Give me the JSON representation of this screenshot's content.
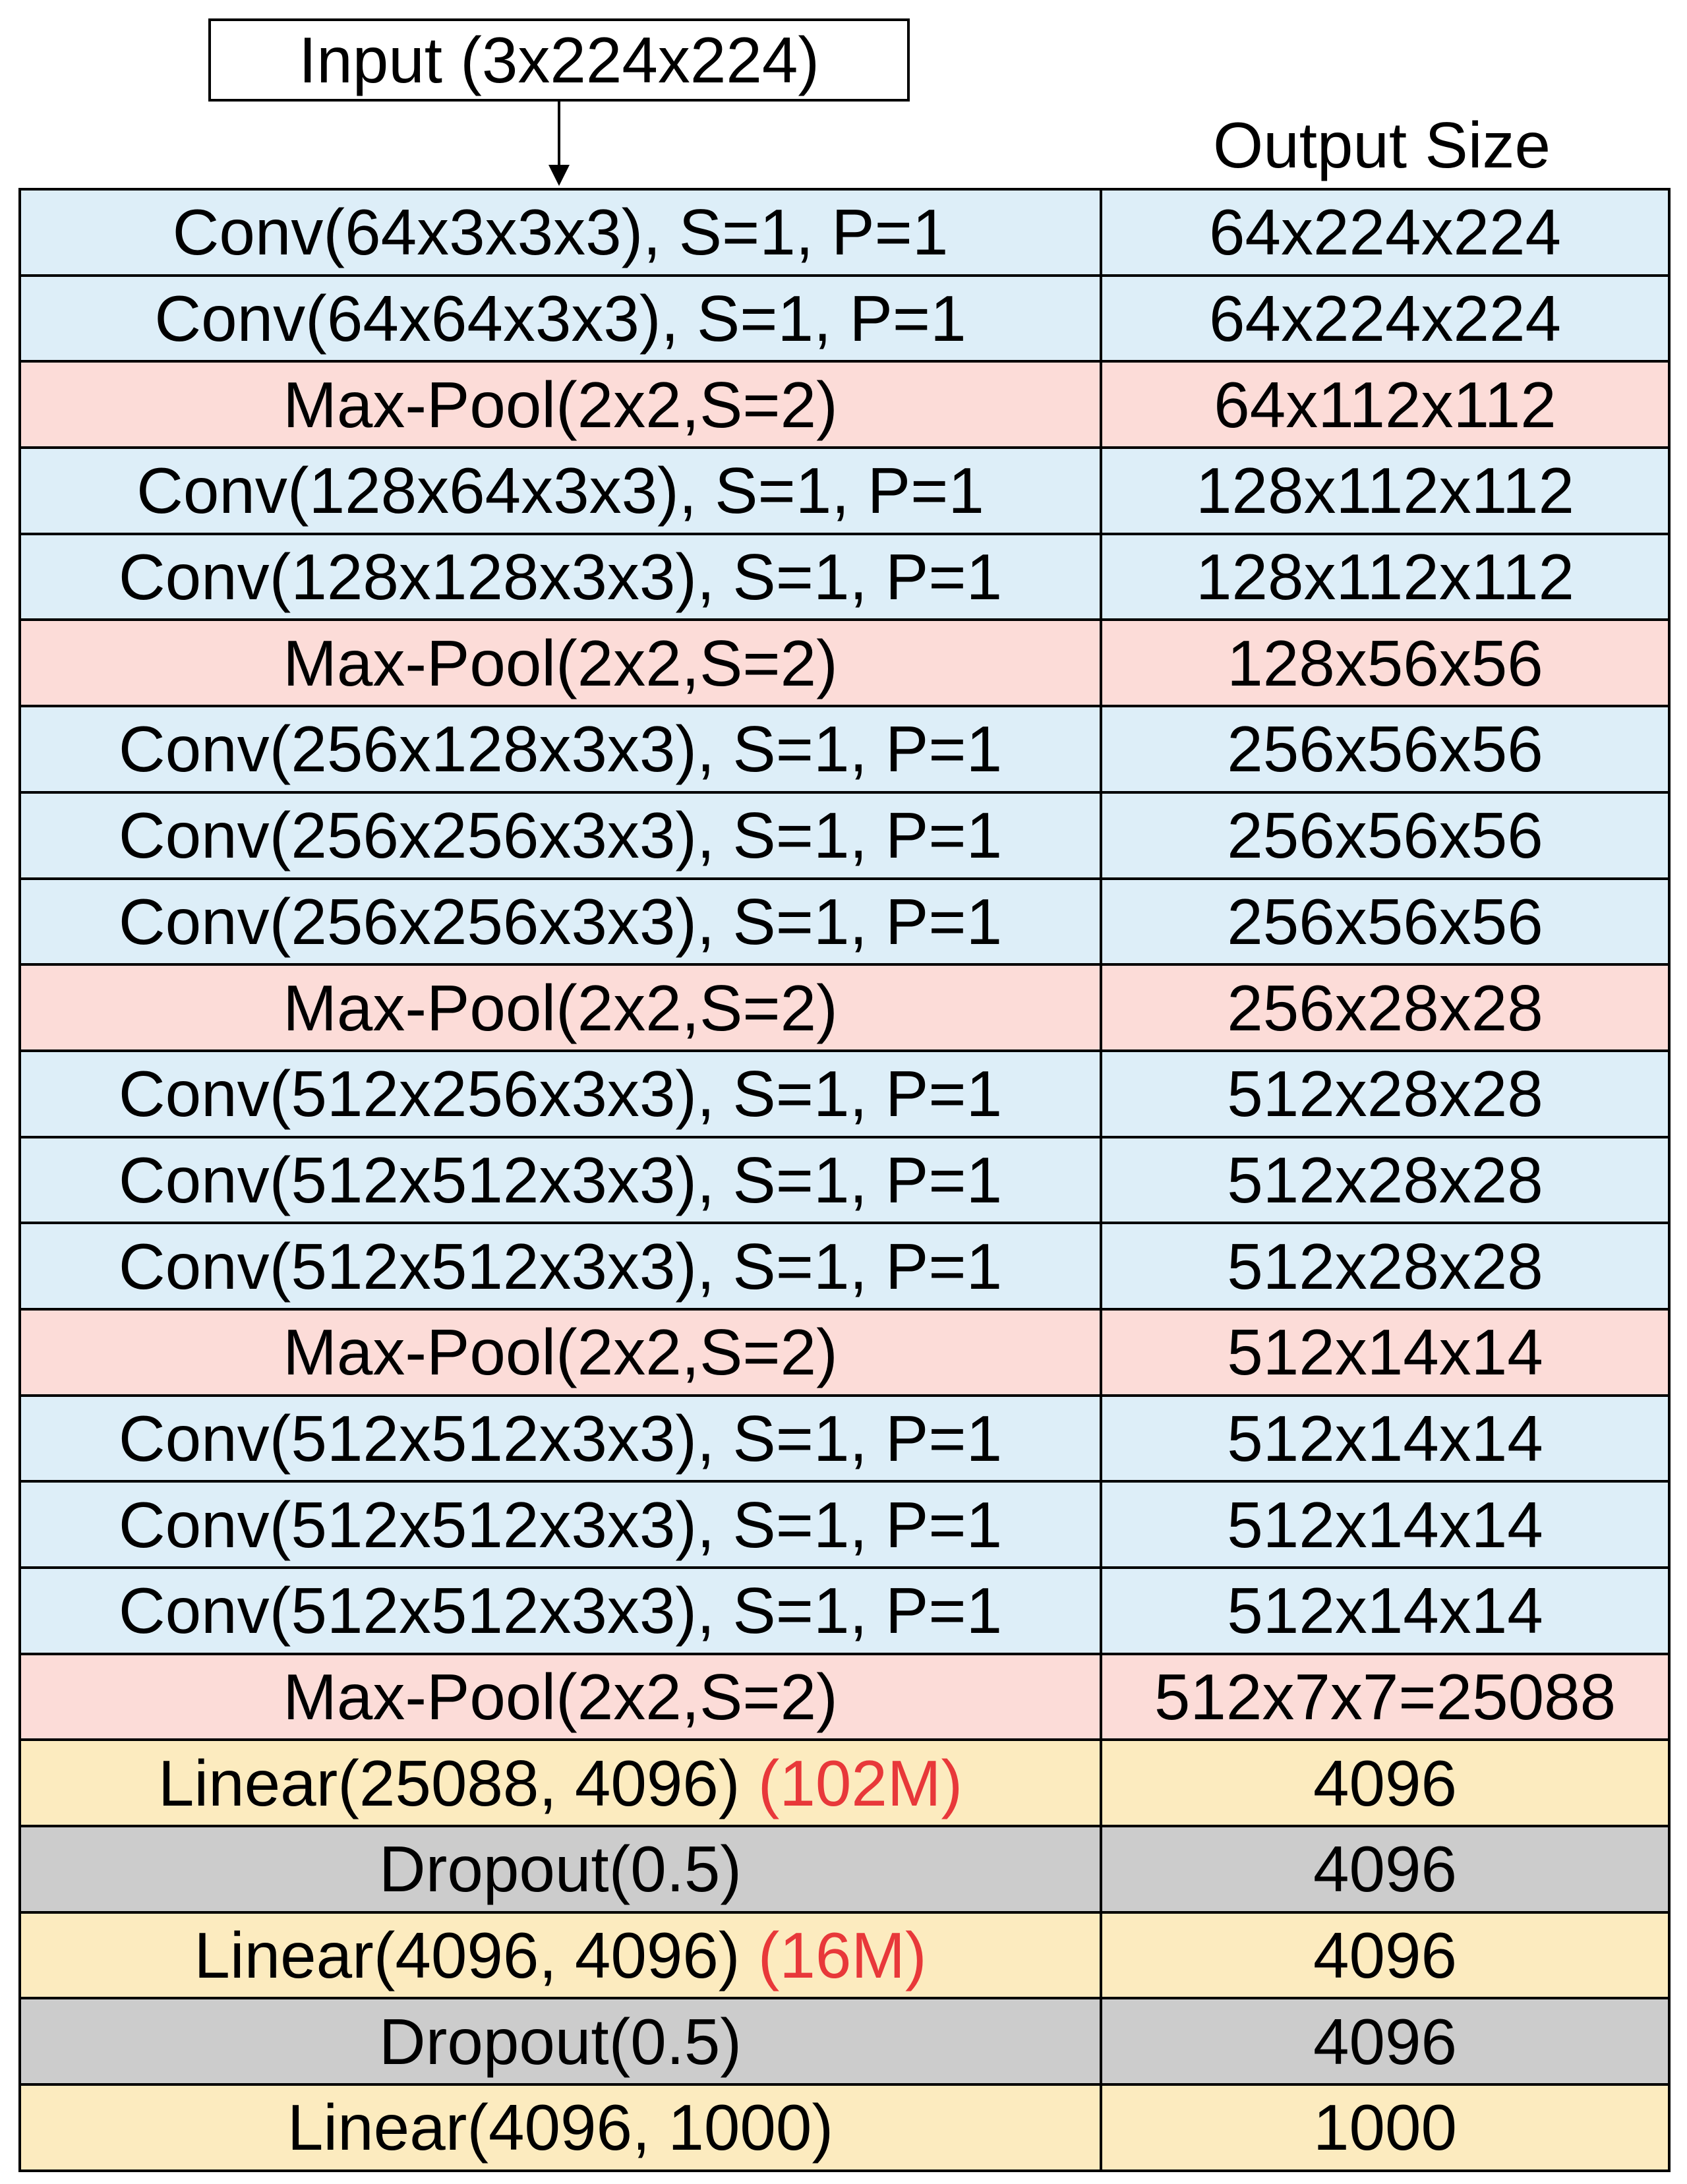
{
  "input_label": "Input (3x224x224)",
  "output_header": "Output Size",
  "colors": {
    "conv": "#ddeef8",
    "pool": "#fcdcd8",
    "linear": "#fcebbf",
    "dropout": "#cccccc",
    "param_count": "#e8383a"
  },
  "layers": [
    {
      "type": "conv",
      "label": "Conv(64x3x3x3), S=1, P=1",
      "param": "",
      "output": "64x224x224"
    },
    {
      "type": "conv",
      "label": "Conv(64x64x3x3), S=1, P=1",
      "param": "",
      "output": "64x224x224"
    },
    {
      "type": "pool",
      "label": "Max-Pool(2x2,S=2)",
      "param": "",
      "output": "64x112x112"
    },
    {
      "type": "conv",
      "label": "Conv(128x64x3x3), S=1, P=1",
      "param": "",
      "output": "128x112x112"
    },
    {
      "type": "conv",
      "label": "Conv(128x128x3x3), S=1, P=1",
      "param": "",
      "output": "128x112x112"
    },
    {
      "type": "pool",
      "label": "Max-Pool(2x2,S=2)",
      "param": "",
      "output": "128x56x56"
    },
    {
      "type": "conv",
      "label": "Conv(256x128x3x3), S=1, P=1",
      "param": "",
      "output": "256x56x56"
    },
    {
      "type": "conv",
      "label": "Conv(256x256x3x3), S=1, P=1",
      "param": "",
      "output": "256x56x56"
    },
    {
      "type": "conv",
      "label": "Conv(256x256x3x3), S=1, P=1",
      "param": "",
      "output": "256x56x56"
    },
    {
      "type": "pool",
      "label": "Max-Pool(2x2,S=2)",
      "param": "",
      "output": "256x28x28"
    },
    {
      "type": "conv",
      "label": "Conv(512x256x3x3), S=1, P=1",
      "param": "",
      "output": "512x28x28"
    },
    {
      "type": "conv",
      "label": "Conv(512x512x3x3), S=1, P=1",
      "param": "",
      "output": "512x28x28"
    },
    {
      "type": "conv",
      "label": "Conv(512x512x3x3), S=1, P=1",
      "param": "",
      "output": "512x28x28"
    },
    {
      "type": "pool",
      "label": "Max-Pool(2x2,S=2)",
      "param": "",
      "output": "512x14x14"
    },
    {
      "type": "conv",
      "label": "Conv(512x512x3x3), S=1, P=1",
      "param": "",
      "output": "512x14x14"
    },
    {
      "type": "conv",
      "label": "Conv(512x512x3x3), S=1, P=1",
      "param": "",
      "output": "512x14x14"
    },
    {
      "type": "conv",
      "label": "Conv(512x512x3x3), S=1, P=1",
      "param": "",
      "output": "512x14x14"
    },
    {
      "type": "pool",
      "label": "Max-Pool(2x2,S=2)",
      "param": "",
      "output": "512x7x7=25088"
    },
    {
      "type": "linear",
      "label": "Linear(25088, 4096)",
      "param": "(102M)",
      "output": "4096"
    },
    {
      "type": "dropout",
      "label": "Dropout(0.5)",
      "param": "",
      "output": "4096"
    },
    {
      "type": "linear",
      "label": "Linear(4096, 4096)",
      "param": "(16M)",
      "output": "4096"
    },
    {
      "type": "dropout",
      "label": "Dropout(0.5)",
      "param": "",
      "output": "4096"
    },
    {
      "type": "linear",
      "label": "Linear(4096, 1000)",
      "param": "",
      "output": "1000"
    }
  ]
}
